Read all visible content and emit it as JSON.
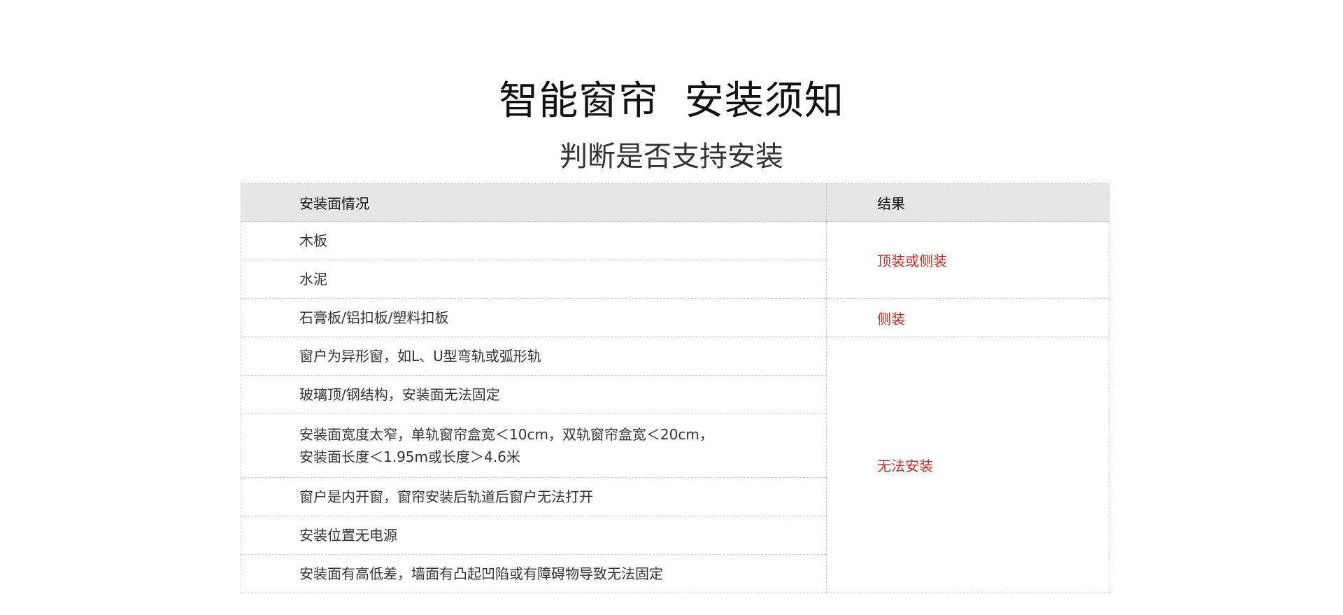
{
  "header": {
    "title": "智能窗帘  安装须知",
    "subtitle": "判断是否支持安装"
  },
  "table": {
    "columns": [
      "安装面情况",
      "结果"
    ],
    "rows": [
      "木板",
      "水泥",
      "石膏板/铝扣板/塑料扣板",
      "窗户为异形窗，如L、U型弯轨或弧形轨",
      "玻璃顶/钢结构，安装面无法固定",
      [
        "安装面宽度太窄，单轨窗帘盒宽＜10cm，双轨窗帘盒宽＜20cm，",
        "安装面长度＜1.95m或长度＞4.6米"
      ],
      "窗户是内开窗，窗帘安装后轨道后窗户无法打开",
      "安装位置无电源",
      "安装面有高低差，墙面有凸起凹陷或有障碍物导致无法固定"
    ],
    "results": [
      "顶装或侧装",
      "侧装",
      "无法安装"
    ]
  },
  "colors": {
    "result_text": "#b5302a",
    "header_bg": "#e6e6e6",
    "border": "#c9c9c9"
  }
}
